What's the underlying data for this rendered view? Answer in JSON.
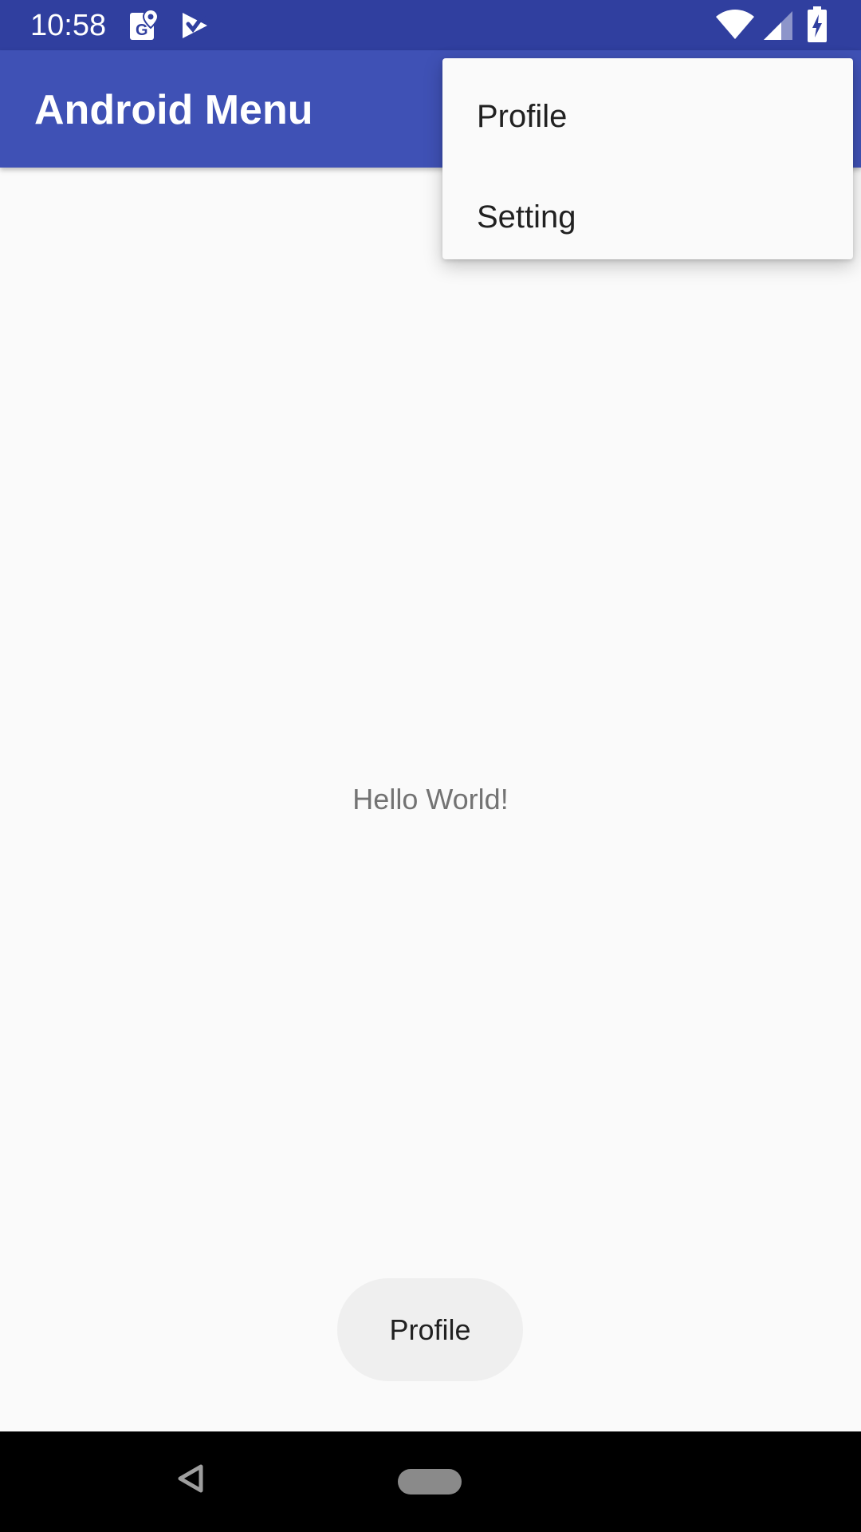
{
  "status_bar": {
    "time": "10:58",
    "icons": [
      "maps-notification-icon",
      "check-notification-icon",
      "wifi-icon",
      "cell-signal-icon",
      "battery-charging-icon"
    ],
    "color": "#303f9f"
  },
  "app_bar": {
    "title": "Android Menu",
    "color": "#3f51b5"
  },
  "popup_menu": {
    "items": [
      {
        "label": "Profile"
      },
      {
        "label": "Setting"
      }
    ]
  },
  "content": {
    "text": "Hello World!"
  },
  "bottom_button": {
    "label": "Profile"
  },
  "nav_bar": {
    "icons": [
      "back-icon",
      "home-pill-icon"
    ]
  }
}
